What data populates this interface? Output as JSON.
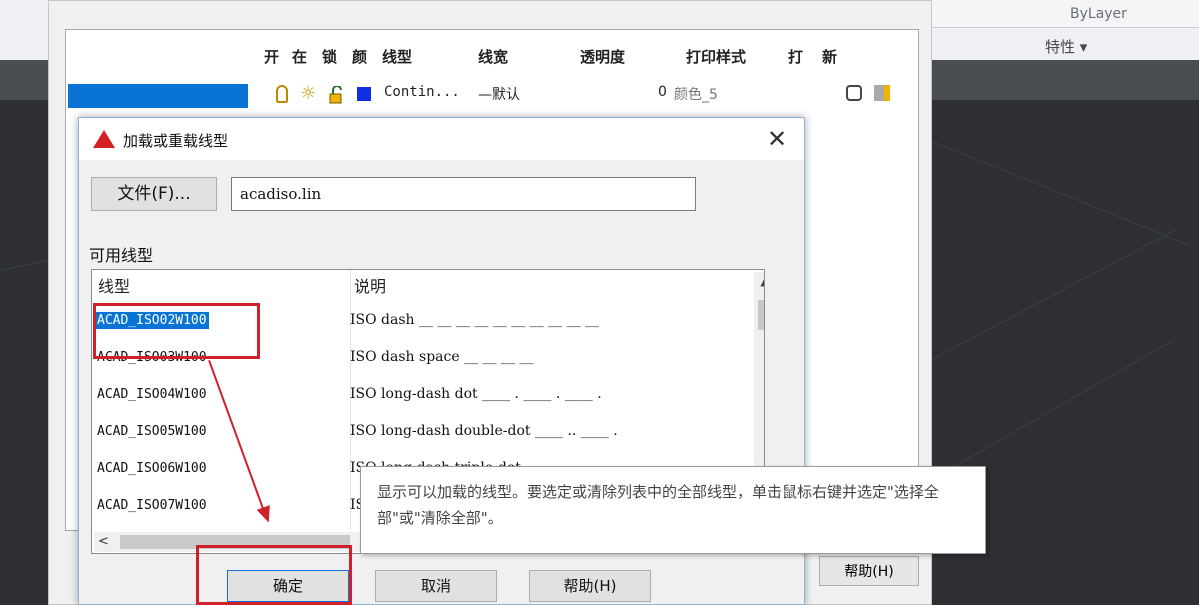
{
  "background": {
    "bylayer_text": "ByLayer",
    "properties_menu": "特性 ▾"
  },
  "layer_manager": {
    "headers": [
      "开",
      "在",
      "锁",
      "颜",
      "线型",
      "线宽",
      "透明度",
      "打印样式",
      "打",
      "新"
    ],
    "row": {
      "linetype": "Contin...",
      "lineweight": "—默认",
      "transparency": "0",
      "plot_style": "颜色_5"
    },
    "help_button": "帮助(H)"
  },
  "dialog": {
    "title": "加载或重载线型",
    "close_glyph": "✕",
    "file_button": "文件(F)...",
    "file_value": "acadiso.lin",
    "available_label": "可用线型",
    "columns": {
      "linetype": "线型",
      "description": "说明"
    },
    "rows": [
      {
        "name": "ACAD_ISO02W100",
        "desc": "ISO dash __ __ __ __ __ __ __ __ __ __",
        "selected": true
      },
      {
        "name": "ACAD_ISO03W100",
        "desc": "ISO dash space __    __    __    __",
        "selected": false
      },
      {
        "name": "ACAD_ISO04W100",
        "desc": "ISO long-dash dot ____ . ____ . ____ .",
        "selected": false
      },
      {
        "name": "ACAD_ISO05W100",
        "desc": "ISO long-dash double-dot ____ .. ____ .",
        "selected": false
      },
      {
        "name": "ACAD_ISO06W100",
        "desc": "ISO long-dash triple-dot",
        "selected": false
      },
      {
        "name": "ACAD_ISO07W100",
        "desc": "ISO dot",
        "selected": false
      }
    ],
    "ok_button": "确定",
    "cancel_button": "取消",
    "help_button": "帮助(H)",
    "tooltip": "显示可以加载的线型。要选定或清除列表中的全部线型，单击鼠标右键并选定\"选择全部\"或\"清除全部\"。"
  },
  "colors": {
    "selection": "#0a74d6",
    "annotation": "#d0202a",
    "layer_color": "#1130e6"
  }
}
